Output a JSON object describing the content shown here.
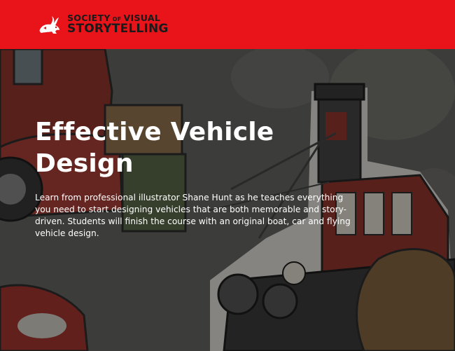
{
  "header": {
    "logo": {
      "icon": "rabbit-logo-icon",
      "line1_main": "SOCIETY",
      "line1_small": "OF",
      "line1_end": "VISUAL",
      "line2": "STORYTELLING"
    },
    "background_color": "#e8141a"
  },
  "hero": {
    "title": "Effective Vehicle Design",
    "description": "Learn from professional illustrator Shane Hunt as he teaches everything you need to start designing vehicles that are both memorable and story-driven. Students will finish the course with an original boat, car and flying vehicle design.",
    "background_image": "vehicle-illustration-image"
  }
}
